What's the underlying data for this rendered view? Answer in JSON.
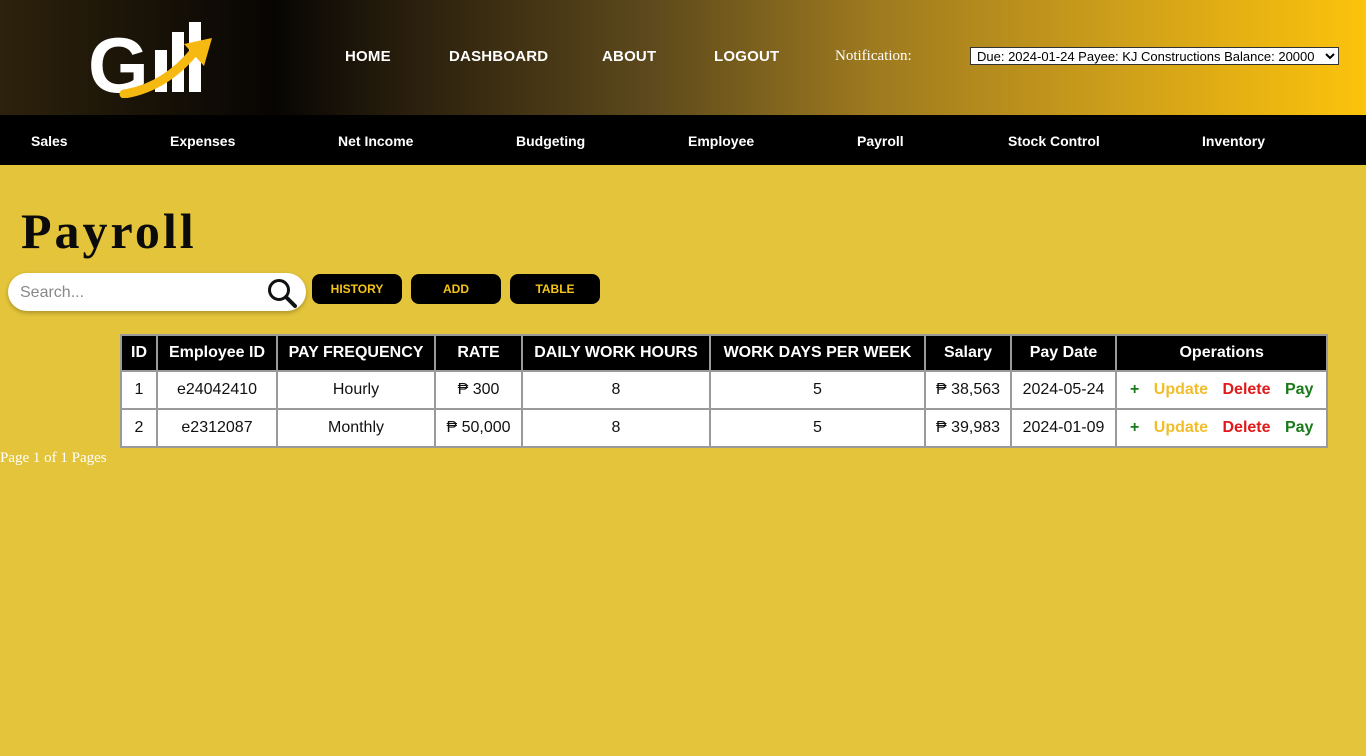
{
  "colors": {
    "background": "#e4c43a",
    "nav_bar": "#000000",
    "button_text": "#f5c518",
    "plus": "#1a7a1a",
    "update": "#f1be2a",
    "delete": "#e01a1a",
    "pay": "#1a7a1a"
  },
  "header": {
    "logo_icon": "gill-logo-icon",
    "nav": [
      "HOME",
      "DASHBOARD",
      "ABOUT",
      "LOGOUT"
    ],
    "notification_label": "Notification:",
    "notification_selected": "Due: 2024-01-24 Payee: KJ Constructions Balance: 20000"
  },
  "subnav": [
    "Sales",
    "Expenses",
    "Net Income",
    "Budgeting",
    "Employee",
    "Payroll",
    "Stock Control",
    "Inventory"
  ],
  "page": {
    "title": "Payroll",
    "search_placeholder": "Search...",
    "buttons": {
      "history": "HISTORY",
      "add": "ADD",
      "table": "TABLE"
    }
  },
  "table": {
    "headers": [
      "ID",
      "Employee ID",
      "PAY FREQUENCY",
      "RATE",
      "DAILY WORK HOURS",
      "WORK DAYS PER WEEK",
      "Salary",
      "Pay Date",
      "Operations"
    ],
    "rows": [
      [
        "1",
        "e24042410",
        "Hourly",
        "₱ 300",
        "8",
        "5",
        "₱ 38,563",
        "2024-05-24"
      ],
      [
        "2",
        "e2312087",
        "Monthly",
        "₱ 50,000",
        "8",
        "5",
        "₱ 39,983",
        "2024-01-09"
      ]
    ],
    "operations": {
      "plus": "+",
      "update": "Update",
      "delete": "Delete",
      "pay": "Pay"
    }
  },
  "pagination": "Page 1 of 1 Pages"
}
